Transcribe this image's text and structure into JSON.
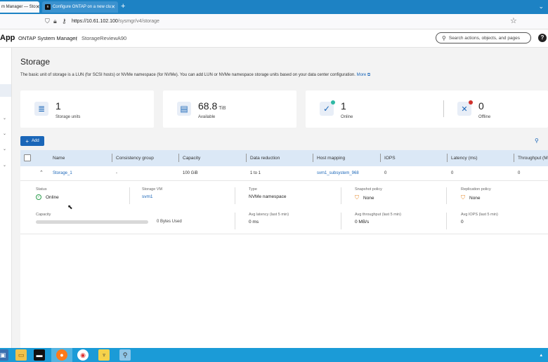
{
  "browser": {
    "tabs": [
      {
        "label": "m Manager — Sto"
      },
      {
        "label": "Configure ONTAP on a new clu"
      }
    ],
    "new_tab": "+",
    "url_host": "https://10.61.102.100",
    "url_path": "/sysmgr/v4/storage"
  },
  "header": {
    "logo": "App",
    "app_name": "ONTAP System Manager",
    "divider": "|",
    "cluster": "StorageReviewA90",
    "search_placeholder": "Search actions, objects, and pages",
    "help": "?"
  },
  "page": {
    "title": "Storage",
    "description": "The basic unit of storage is a LUN (for SCSI hosts) or NVMe namespace (for NVMe). You can add LUN or NVMe namespace storage units based on your data center configuration.",
    "more_link": "More"
  },
  "summary": {
    "storage_units": {
      "value": "1",
      "label": "Storage units"
    },
    "available": {
      "value": "68.8",
      "unit": "TiB",
      "label": "Available"
    },
    "online": {
      "value": "1",
      "label": "Online"
    },
    "offline": {
      "value": "0",
      "label": "Offline"
    }
  },
  "toolbar": {
    "add_label": "Add"
  },
  "table": {
    "columns": [
      "Name",
      "Consistency group",
      "Capacity",
      "Data reduction",
      "Host mapping",
      "IOPS",
      "Latency (ms)",
      "Throughput (M"
    ],
    "rows": [
      {
        "name": "Storage_1",
        "consistency_group": "-",
        "capacity": "100 GiB",
        "data_reduction": "1 to 1",
        "host_mapping": "svm1_subsystem_968",
        "iops": "0",
        "latency": "0",
        "throughput": "0"
      }
    ]
  },
  "detail": {
    "status_label": "Status",
    "status_value": "Online",
    "storage_vm_label": "Storage VM",
    "storage_vm_value": "svm1",
    "type_label": "Type",
    "type_value": "NVMe namespace",
    "snapshot_label": "Snapshot policy",
    "snapshot_value": "None",
    "replication_label": "Replication policy",
    "replication_value": "None",
    "capacity_label": "Capacity",
    "capacity_used": "0 Bytes Used",
    "capacity_fraction": 0,
    "avg_latency_label": "Avg latency (last 5 min)",
    "avg_latency_value": "0 ms",
    "avg_throughput_label": "Avg throughput (last 5 min)",
    "avg_throughput_value": "0 MB/s",
    "avg_iops_label": "Avg IOPS (last 5 min)",
    "avg_iops_value": "0"
  },
  "colors": {
    "accent": "#1a66b8",
    "browser_bar": "#1d82c4",
    "taskbar": "#1b9bd7",
    "online_badge": "#2e9e4e",
    "offline_badge": "#d0312d",
    "table_header": "#dbe8f6"
  },
  "icons": [
    "shield-icon",
    "lock-icon",
    "key-icon",
    "star-icon",
    "search-icon",
    "help-icon",
    "database-icon",
    "storage-icon",
    "check-circle-icon",
    "x-circle-icon",
    "plus-icon",
    "chevron-up-icon",
    "check-icon",
    "warning-shield-icon",
    "external-link-icon"
  ]
}
